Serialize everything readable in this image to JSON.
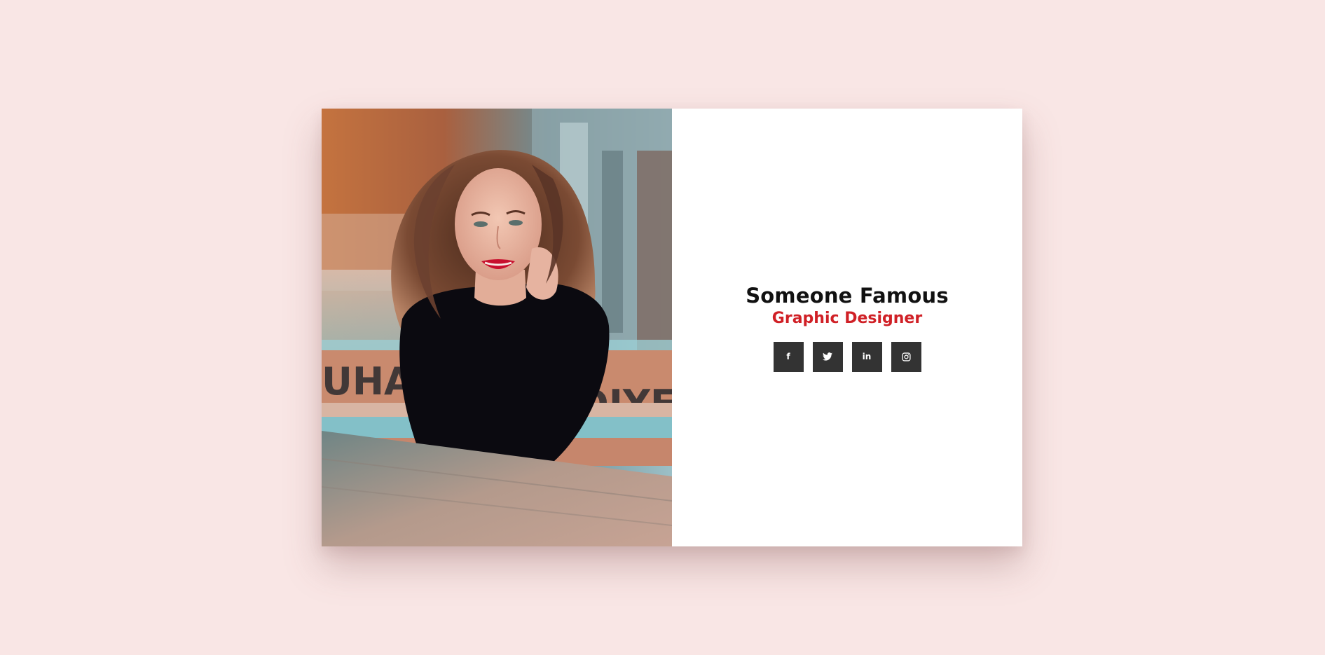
{
  "profile": {
    "name": "Someone Famous",
    "role": "Graphic Designer"
  },
  "photo": {
    "alt": "Portrait photo",
    "bench_text_left": "UHAN",
    "bench_text_right": "DIYE"
  },
  "social_links": [
    {
      "icon": "facebook-icon",
      "label": "f"
    },
    {
      "icon": "twitter-icon",
      "label": ""
    },
    {
      "icon": "linkedin-icon",
      "label": "in"
    },
    {
      "icon": "instagram-icon",
      "label": ""
    }
  ],
  "colors": {
    "background": "#f9e6e5",
    "name": "#111111",
    "role": "#d02026",
    "social_button": "#333333"
  }
}
